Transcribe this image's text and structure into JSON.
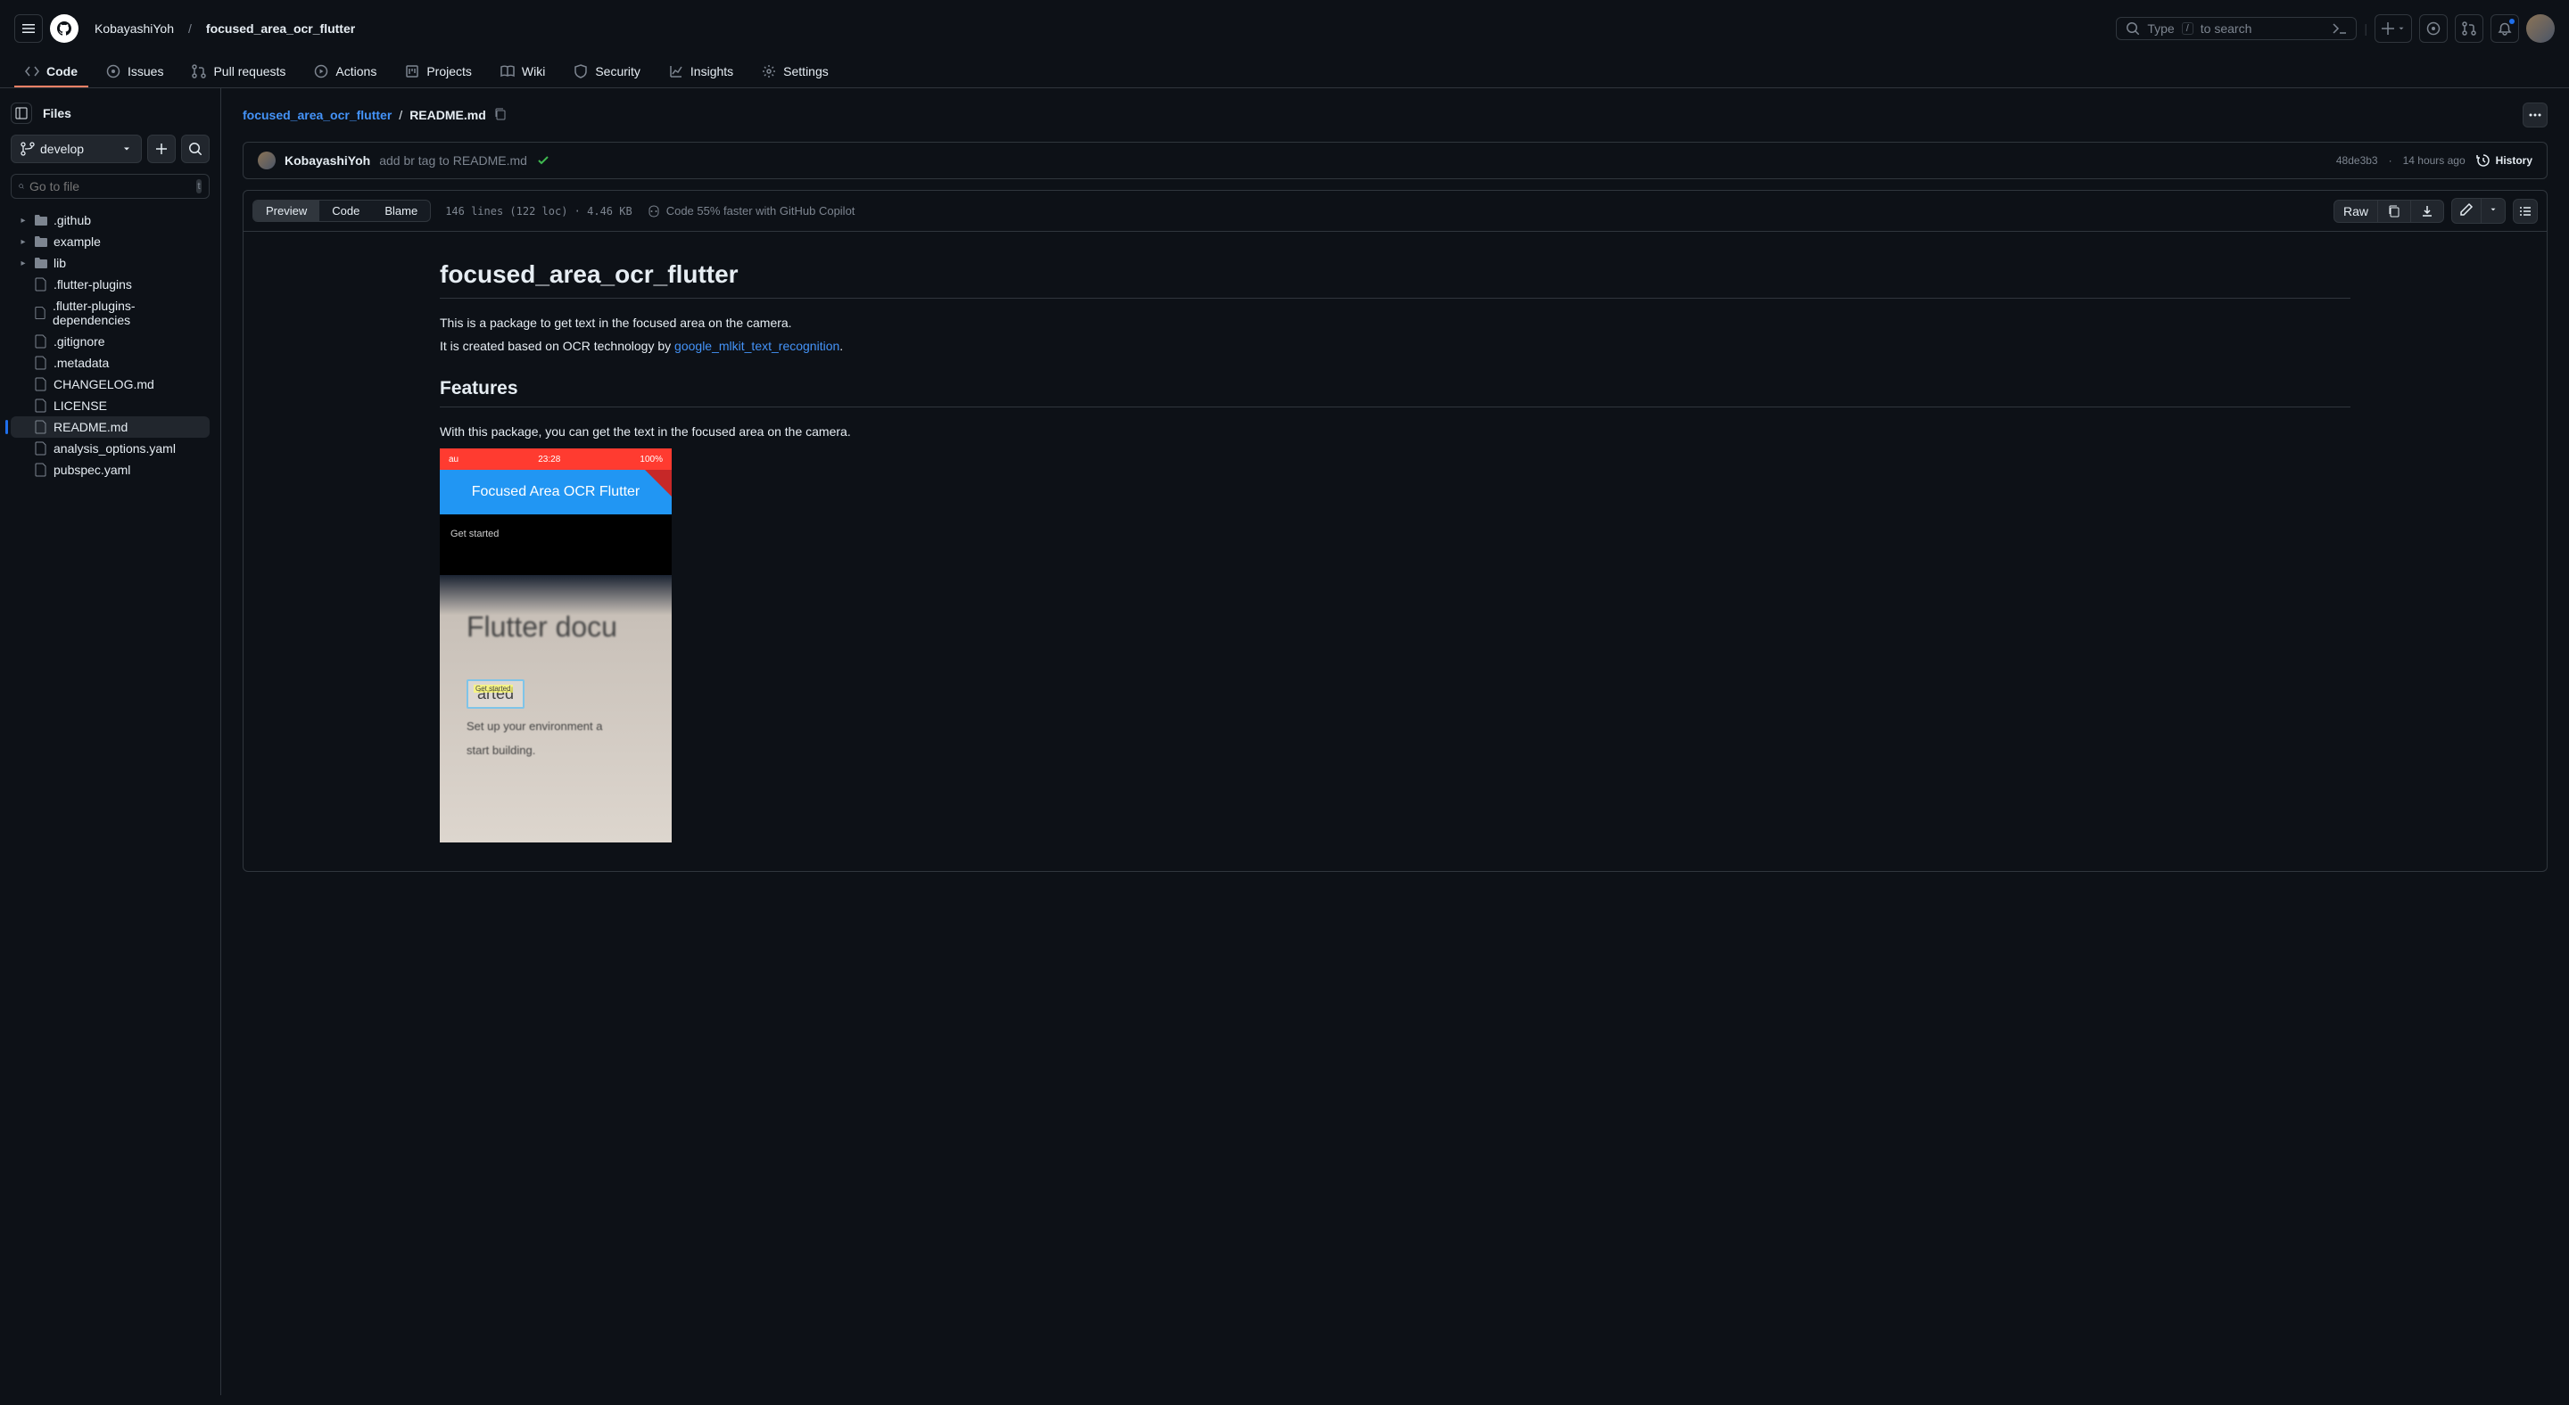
{
  "header": {
    "owner": "KobayashiYoh",
    "repo": "focused_area_ocr_flutter",
    "search_prefix": "Type",
    "search_key": "/",
    "search_suffix": "to search"
  },
  "nav": {
    "code": "Code",
    "issues": "Issues",
    "pulls": "Pull requests",
    "actions": "Actions",
    "projects": "Projects",
    "wiki": "Wiki",
    "security": "Security",
    "insights": "Insights",
    "settings": "Settings"
  },
  "sidebar": {
    "files_label": "Files",
    "branch": "develop",
    "filter_placeholder": "Go to file",
    "filter_key": "t",
    "tree": {
      "github": ".github",
      "example": "example",
      "lib": "lib",
      "flutter_plugins": ".flutter-plugins",
      "flutter_plugins_deps": ".flutter-plugins-dependencies",
      "gitignore": ".gitignore",
      "metadata": ".metadata",
      "changelog": "CHANGELOG.md",
      "license": "LICENSE",
      "readme": "README.md",
      "analysis": "analysis_options.yaml",
      "pubspec": "pubspec.yaml"
    }
  },
  "path": {
    "repo": "focused_area_ocr_flutter",
    "file": "README.md"
  },
  "commit": {
    "author": "KobayashiYoh",
    "message": "add br tag to README.md",
    "sha": "48de3b3",
    "time": "14 hours ago",
    "history": "History"
  },
  "toolbar": {
    "preview": "Preview",
    "code": "Code",
    "blame": "Blame",
    "meta": "146 lines (122 loc) · 4.46 KB",
    "copilot": "Code 55% faster with GitHub Copilot",
    "raw": "Raw"
  },
  "readme": {
    "h1": "focused_area_ocr_flutter",
    "p1": "This is a package to get text in the focused area on the camera.",
    "p2a": "It is created based on OCR technology by ",
    "p2_link": "google_mlkit_text_recognition",
    "p2b": ".",
    "h2": "Features",
    "p3": "With this package, you can get the text in the focused area on the camera.",
    "mock": {
      "carrier": "au",
      "time": "23:28",
      "battery": "100%",
      "app_title": "Focused Area OCR Flutter",
      "result": "Get started",
      "doc_title": "Flutter docu",
      "focus_label": "Get started",
      "focus_text": "arted",
      "sub1": "Set up your environment a",
      "sub2": "start building."
    }
  }
}
